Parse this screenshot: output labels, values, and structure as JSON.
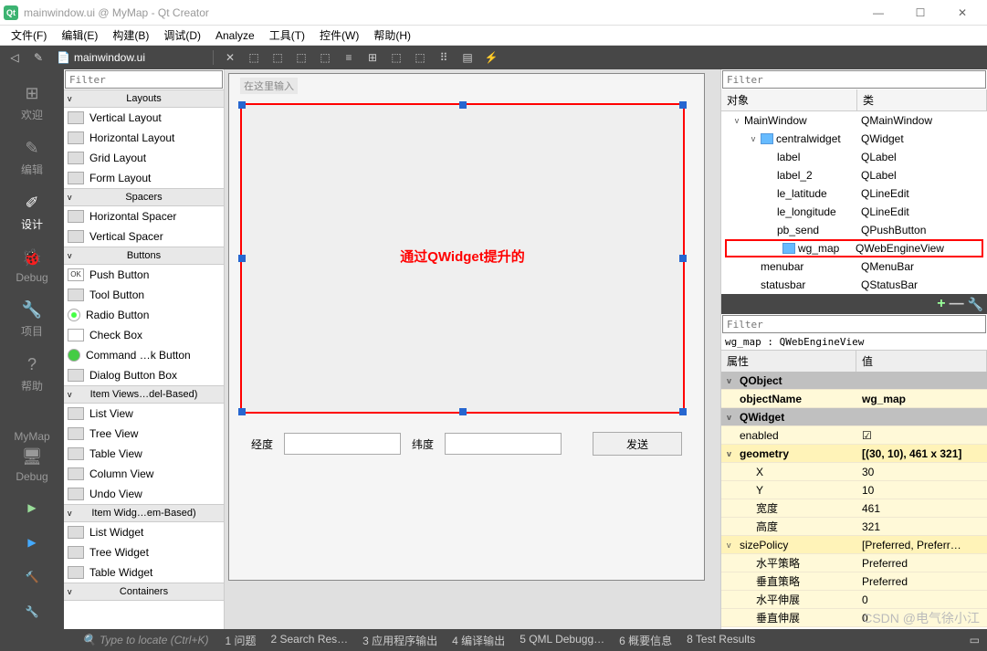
{
  "title": "mainwindow.ui @ MyMap - Qt Creator",
  "menus": [
    "文件(F)",
    "编辑(E)",
    "构建(B)",
    "调试(D)",
    "Analyze",
    "工具(T)",
    "控件(W)",
    "帮助(H)"
  ],
  "editing_file": "mainwindow.ui",
  "sidebar": {
    "items": [
      {
        "label": "欢迎",
        "icon": "⊞"
      },
      {
        "label": "编辑",
        "icon": "✎"
      },
      {
        "label": "设计",
        "icon": "✐",
        "active": true
      },
      {
        "label": "Debug",
        "icon": "🐞"
      },
      {
        "label": "项目",
        "icon": "🔧"
      },
      {
        "label": "帮助",
        "icon": "?"
      }
    ],
    "target": "MyMap",
    "target_sub": "Debug"
  },
  "widgetbox": {
    "filter_placeholder": "Filter",
    "categories": [
      {
        "name": "Layouts",
        "items": [
          "Vertical Layout",
          "Horizontal Layout",
          "Grid Layout",
          "Form Layout"
        ]
      },
      {
        "name": "Spacers",
        "items": [
          "Horizontal Spacer",
          "Vertical Spacer"
        ]
      },
      {
        "name": "Buttons",
        "items": [
          "Push Button",
          "Tool Button",
          "Radio Button",
          "Check Box",
          "Command …k Button",
          "Dialog Button Box"
        ],
        "icons": [
          "ok",
          "tool",
          "rad",
          "chk",
          "cmd",
          "dlg"
        ]
      },
      {
        "name": "Item Views…del-Based)",
        "items": [
          "List View",
          "Tree View",
          "Table View",
          "Column View",
          "Undo View"
        ]
      },
      {
        "name": "Item Widg…em-Based)",
        "items": [
          "List Widget",
          "Tree Widget",
          "Table Widget"
        ]
      },
      {
        "name": "Containers",
        "items": []
      }
    ]
  },
  "canvas": {
    "input_hint": "在这里输入",
    "overlay_text": "通过QWidget提升的",
    "lbl_longitude": "经度",
    "lbl_latitude": "纬度",
    "btn_send": "发送"
  },
  "object_inspector": {
    "filter_placeholder": "Filter",
    "col_object": "对象",
    "col_class": "类",
    "rows": [
      {
        "indent": 0,
        "expand": "v",
        "name": "MainWindow",
        "class": "QMainWindow"
      },
      {
        "indent": 1,
        "expand": "v",
        "name": "centralwidget",
        "class": "QWidget",
        "icon": true
      },
      {
        "indent": 2,
        "name": "label",
        "class": "QLabel"
      },
      {
        "indent": 2,
        "name": "label_2",
        "class": "QLabel"
      },
      {
        "indent": 2,
        "name": "le_latitude",
        "class": "QLineEdit"
      },
      {
        "indent": 2,
        "name": "le_longitude",
        "class": "QLineEdit"
      },
      {
        "indent": 2,
        "name": "pb_send",
        "class": "QPushButton"
      },
      {
        "indent": 2,
        "name": "wg_map",
        "class": "QWebEngineView",
        "selected": true,
        "icon": true
      },
      {
        "indent": 1,
        "name": "menubar",
        "class": "QMenuBar"
      },
      {
        "indent": 1,
        "name": "statusbar",
        "class": "QStatusBar"
      }
    ]
  },
  "property_editor": {
    "filter_placeholder": "Filter",
    "object_path": "wg_map : QWebEngineView",
    "col_prop": "属性",
    "col_val": "值",
    "rows": [
      {
        "type": "sect",
        "name": "QObject"
      },
      {
        "name": "objectName",
        "value": "wg_map",
        "bold": true,
        "cls": "yellow"
      },
      {
        "type": "sect",
        "name": "QWidget"
      },
      {
        "name": "enabled",
        "value": "☑",
        "cls": "yellow"
      },
      {
        "name": "geometry",
        "value": "[(30, 10), 461 x 321]",
        "bold": true,
        "expand": "v",
        "cls": "yellow2"
      },
      {
        "name": "X",
        "value": "30",
        "indent": 1,
        "cls": "yellow"
      },
      {
        "name": "Y",
        "value": "10",
        "indent": 1,
        "cls": "yellow"
      },
      {
        "name": "宽度",
        "value": "461",
        "indent": 1,
        "cls": "yellow"
      },
      {
        "name": "高度",
        "value": "321",
        "indent": 1,
        "cls": "yellow"
      },
      {
        "name": "sizePolicy",
        "value": "[Preferred, Preferr…",
        "expand": "v",
        "cls": "yellow2"
      },
      {
        "name": "水平策略",
        "value": "Preferred",
        "indent": 1,
        "cls": "yellow"
      },
      {
        "name": "垂直策略",
        "value": "Preferred",
        "indent": 1,
        "cls": "yellow"
      },
      {
        "name": "水平伸展",
        "value": "0",
        "indent": 1,
        "cls": "yellow"
      },
      {
        "name": "垂直伸展",
        "value": "0",
        "indent": 1,
        "cls": "yellow"
      }
    ]
  },
  "statusbar": {
    "locator": "Type to locate (Ctrl+K)",
    "tabs": [
      "1 问题",
      "2 Search Res…",
      "3 应用程序输出",
      "4 编译输出",
      "5 QML Debugg…",
      "6 概要信息",
      "8 Test Results"
    ]
  },
  "watermark": "CSDN @电气徐小江"
}
